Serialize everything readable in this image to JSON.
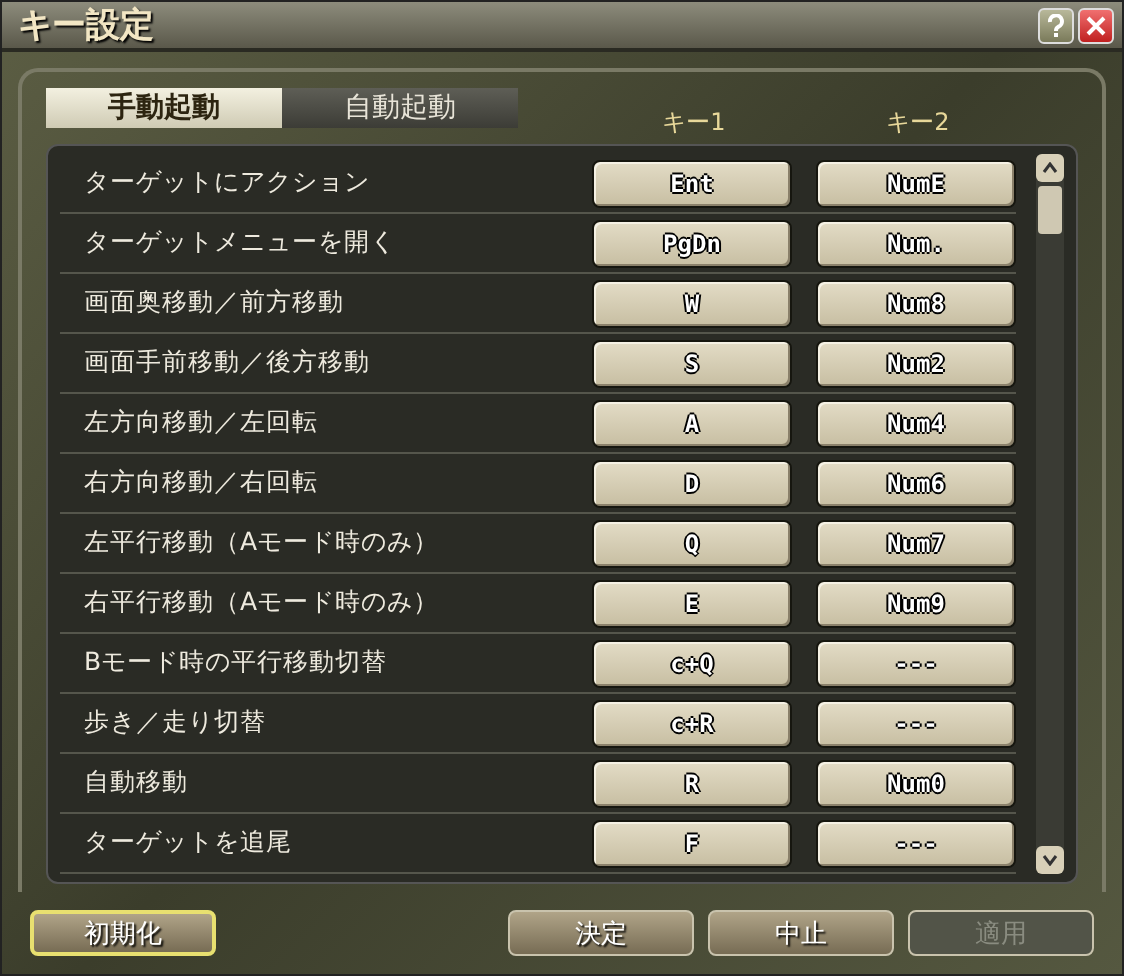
{
  "window": {
    "title": "キー設定"
  },
  "tabs": [
    {
      "label": "手動起動",
      "selected": true
    },
    {
      "label": "自動起動",
      "selected": false
    }
  ],
  "columns": [
    "キー1",
    "キー2"
  ],
  "rows": [
    {
      "action": "ターゲットにアクション",
      "key1": "Ent",
      "key2": "NumE"
    },
    {
      "action": "ターゲットメニューを開く",
      "key1": "PgDn",
      "key2": "Num."
    },
    {
      "action": "画面奥移動／前方移動",
      "key1": "W",
      "key2": "Num8"
    },
    {
      "action": "画面手前移動／後方移動",
      "key1": "S",
      "key2": "Num2"
    },
    {
      "action": "左方向移動／左回転",
      "key1": "A",
      "key2": "Num4"
    },
    {
      "action": "右方向移動／右回転",
      "key1": "D",
      "key2": "Num6"
    },
    {
      "action": "左平行移動（Aモード時のみ）",
      "key1": "Q",
      "key2": "Num7"
    },
    {
      "action": "右平行移動（Aモード時のみ）",
      "key1": "E",
      "key2": "Num9"
    },
    {
      "action": "Bモード時の平行移動切替",
      "key1": "c+Q",
      "key2": "---"
    },
    {
      "action": "歩き／走り切替",
      "key1": "c+R",
      "key2": "---"
    },
    {
      "action": "自動移動",
      "key1": "R",
      "key2": "Num0"
    },
    {
      "action": "ターゲットを追尾",
      "key1": "F",
      "key2": "---"
    }
  ],
  "buttons": [
    {
      "label": "初期化",
      "disabled": false,
      "focused": true
    },
    {
      "label": "決定",
      "disabled": false,
      "focused": false
    },
    {
      "label": "中止",
      "disabled": false,
      "focused": false
    },
    {
      "label": "適用",
      "disabled": true,
      "focused": false
    }
  ]
}
